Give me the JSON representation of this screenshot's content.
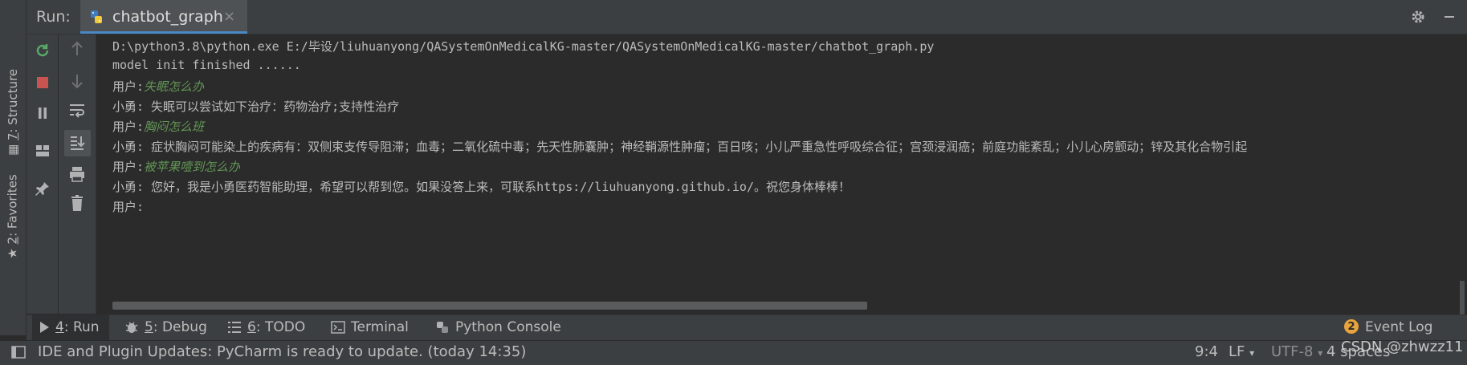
{
  "header": {
    "run_label": "Run:",
    "tab_title": "chatbot_graph",
    "tab_close": "×",
    "settings_icon": "gear-icon",
    "minimize_icon": "minimize-icon"
  },
  "left_strip": {
    "structure": {
      "num": "7",
      "label": ": Structure"
    },
    "favorites": {
      "num": "2",
      "label": ": Favorites"
    }
  },
  "console": {
    "lines": [
      {
        "text": "D:\\python3.8\\python.exe E:/毕设/liuhuanyong/QASystemOnMedicalKG-master/QASystemOnMedicalKG-master/chatbot_graph.py"
      },
      {
        "text": "model init finished ......"
      },
      {
        "prefix": "用户:",
        "input": "失眠怎么办"
      },
      {
        "text": "小勇: 失眠可以尝试如下治疗：药物治疗;支持性治疗"
      },
      {
        "prefix": "用户:",
        "input": "胸闷怎么班"
      },
      {
        "text": "小勇: 症状胸闷可能染上的疾病有：双侧束支传导阻滞；血毒；二氧化硫中毒；先天性肺囊肿；神经鞘源性肿瘤；百日咳；小儿严重急性呼吸综合征；宫颈浸润癌；前庭功能紊乱；小儿心房颤动；锌及其化合物引起"
      },
      {
        "prefix": "用户:",
        "input": "被苹果噎到怎么办"
      },
      {
        "text": "小勇: 您好，我是小勇医药智能助理，希望可以帮到您。如果没答上来，可联系https://liuhuanyong.github.io/。祝您身体棒棒！"
      },
      {
        "prefix": "用户:"
      }
    ]
  },
  "bottom_tabs": [
    {
      "num": "4",
      "label": ": Run",
      "icon": "run-icon"
    },
    {
      "num": "5",
      "label": ": Debug",
      "icon": "bug-icon"
    },
    {
      "num": "6",
      "label": ": TODO",
      "icon": "todo-icon"
    },
    {
      "label": "Terminal",
      "icon": "terminal-icon"
    },
    {
      "label": "Python Console",
      "icon": "python-console-icon"
    }
  ],
  "event_log": {
    "count": "2",
    "label": "Event Log"
  },
  "status": {
    "message": "IDE and Plugin Updates: PyCharm is ready to update. (today 14:35)",
    "position": "9:4",
    "line_sep": "LF",
    "encoding": "UTF-8",
    "indent": "4 spaces",
    "watermark": "CSDN @zhwzz11"
  },
  "colors": {
    "background": "#2b2b2b",
    "panel": "#3c3f41",
    "user_input": "#629755",
    "run_green": "#59a869",
    "stop_red": "#c75450"
  }
}
